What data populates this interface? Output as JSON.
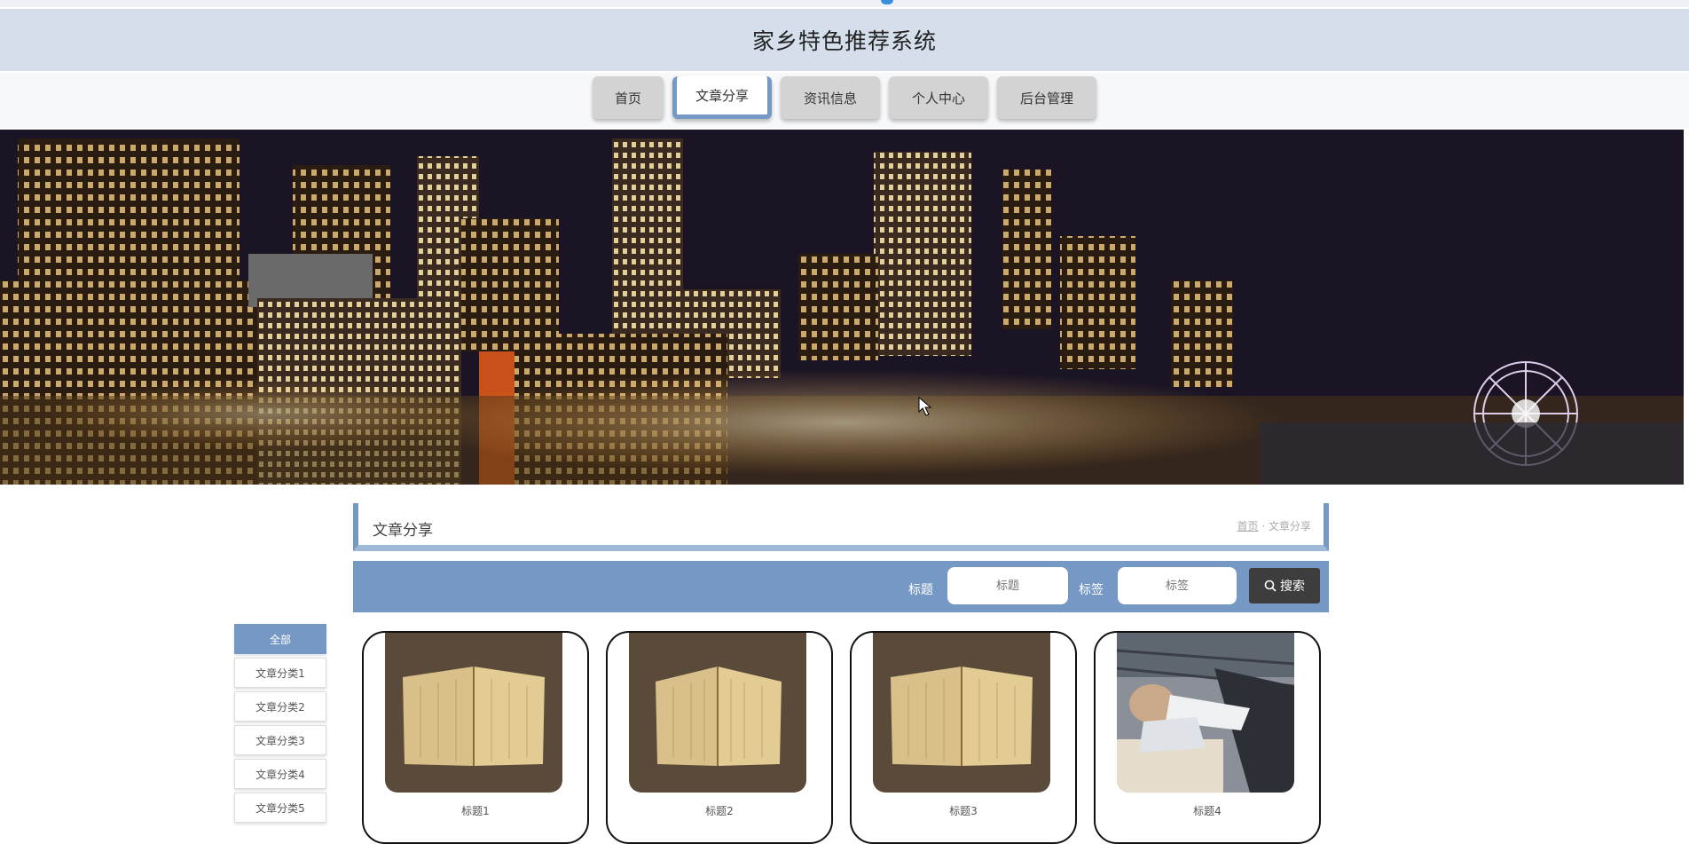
{
  "header": {
    "title": "家乡特色推荐系统"
  },
  "nav": {
    "tabs": [
      {
        "label": "首页",
        "active": false
      },
      {
        "label": "文章分享",
        "active": true
      },
      {
        "label": "资讯信息",
        "active": false
      },
      {
        "label": "个人中心",
        "active": false
      },
      {
        "label": "后台管理",
        "active": false
      }
    ]
  },
  "section": {
    "title": "文章分享",
    "breadcrumb_home": "首页",
    "breadcrumb_current": "文章分享"
  },
  "search": {
    "title_label": "标题",
    "title_placeholder": "标题",
    "tag_label": "标签",
    "tag_placeholder": "标签",
    "button_label": "搜索"
  },
  "sidebar": {
    "items": [
      {
        "label": "全部",
        "active": true
      },
      {
        "label": "文章分类1",
        "active": false
      },
      {
        "label": "文章分类2",
        "active": false
      },
      {
        "label": "文章分类3",
        "active": false
      },
      {
        "label": "文章分类4",
        "active": false
      },
      {
        "label": "文章分类5",
        "active": false
      }
    ]
  },
  "cards": [
    {
      "label": "标题1",
      "image": "open-book"
    },
    {
      "label": "标题2",
      "image": "open-book"
    },
    {
      "label": "标题3",
      "image": "open-book"
    },
    {
      "label": "标题4",
      "image": "library-reading"
    }
  ],
  "colors": {
    "accent": "#7698c4",
    "header_bg": "#d4dfeb",
    "search_button": "#3d3d3d"
  }
}
